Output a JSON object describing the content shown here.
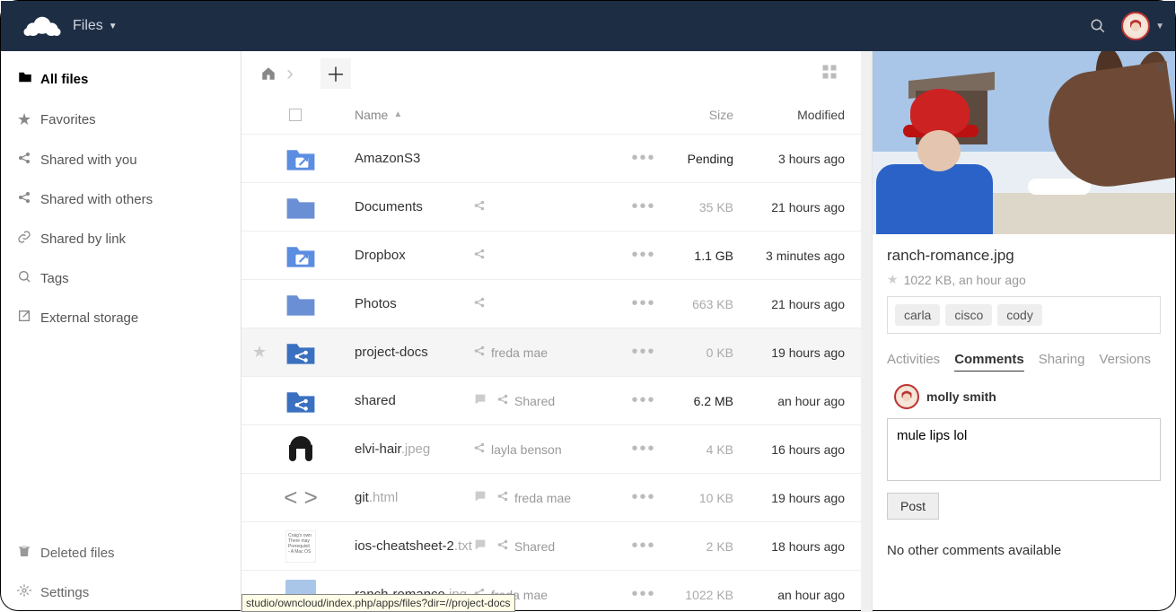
{
  "header": {
    "app_name": "Files"
  },
  "sidebar": {
    "items": [
      {
        "label": "All files",
        "icon": "folder",
        "active": true
      },
      {
        "label": "Favorites",
        "icon": "star"
      },
      {
        "label": "Shared with you",
        "icon": "share"
      },
      {
        "label": "Shared with others",
        "icon": "share"
      },
      {
        "label": "Shared by link",
        "icon": "link"
      },
      {
        "label": "Tags",
        "icon": "tag"
      },
      {
        "label": "External storage",
        "icon": "external"
      }
    ],
    "bottom": [
      {
        "label": "Deleted files",
        "icon": "trash"
      },
      {
        "label": "Settings",
        "icon": "gear"
      }
    ]
  },
  "table": {
    "columns": {
      "name": "Name",
      "size": "Size",
      "modified": "Modified"
    },
    "rows": [
      {
        "name": "AmazonS3",
        "ext": "",
        "type": "external",
        "share": "",
        "size": "Pending",
        "size_dark": true,
        "modified": "3 hours ago",
        "comment": false
      },
      {
        "name": "Documents",
        "ext": "",
        "type": "folder",
        "share": "share-only",
        "size": "35 KB",
        "modified": "21 hours ago",
        "comment": false
      },
      {
        "name": "Dropbox",
        "ext": "",
        "type": "external",
        "share": "share-only",
        "size": "1.1 GB",
        "size_dark": true,
        "modified": "3 minutes ago",
        "comment": false
      },
      {
        "name": "Photos",
        "ext": "",
        "type": "folder",
        "share": "share-only",
        "size": "663 KB",
        "modified": "21 hours ago",
        "comment": false
      },
      {
        "name": "project-docs",
        "ext": "",
        "type": "shared-folder",
        "share": "freda mae",
        "size": "0 KB",
        "modified": "19 hours ago",
        "hover": true,
        "comment": false
      },
      {
        "name": "shared",
        "ext": "",
        "type": "shared-folder",
        "share": "Shared",
        "size": "6.2 MB",
        "size_dark": true,
        "modified": "an hour ago",
        "comment": true
      },
      {
        "name": "elvi-hair",
        "ext": ".jpeg",
        "type": "image-hair",
        "share": "layla benson",
        "size": "4 KB",
        "modified": "16 hours ago",
        "comment": false
      },
      {
        "name": "git",
        "ext": ".html",
        "type": "code",
        "share": "freda mae",
        "size": "10 KB",
        "modified": "19 hours ago",
        "comment": true
      },
      {
        "name": "ios-cheatsheet-2",
        "ext": ".txt",
        "type": "text",
        "share": "Shared",
        "size": "2 KB",
        "modified": "18 hours ago",
        "comment": true
      },
      {
        "name": "ranch-romance",
        "ext": ".jpg",
        "type": "image-ranch",
        "share": "freda mae",
        "size": "1022 KB",
        "modified": "an hour ago",
        "comment": false
      }
    ]
  },
  "details": {
    "filename": "ranch-romance.jpg",
    "meta": "1022 KB, an hour ago",
    "tags": [
      "carla",
      "cisco",
      "cody"
    ],
    "tabs": [
      "Activities",
      "Comments",
      "Sharing",
      "Versions"
    ],
    "active_tab": "Comments",
    "commenter": "molly smith",
    "comment_draft": "mule lips lol",
    "post_label": "Post",
    "no_comments": "No other comments available"
  },
  "status_bar": "studio/owncloud/index.php/apps/files?dir=//project-docs"
}
